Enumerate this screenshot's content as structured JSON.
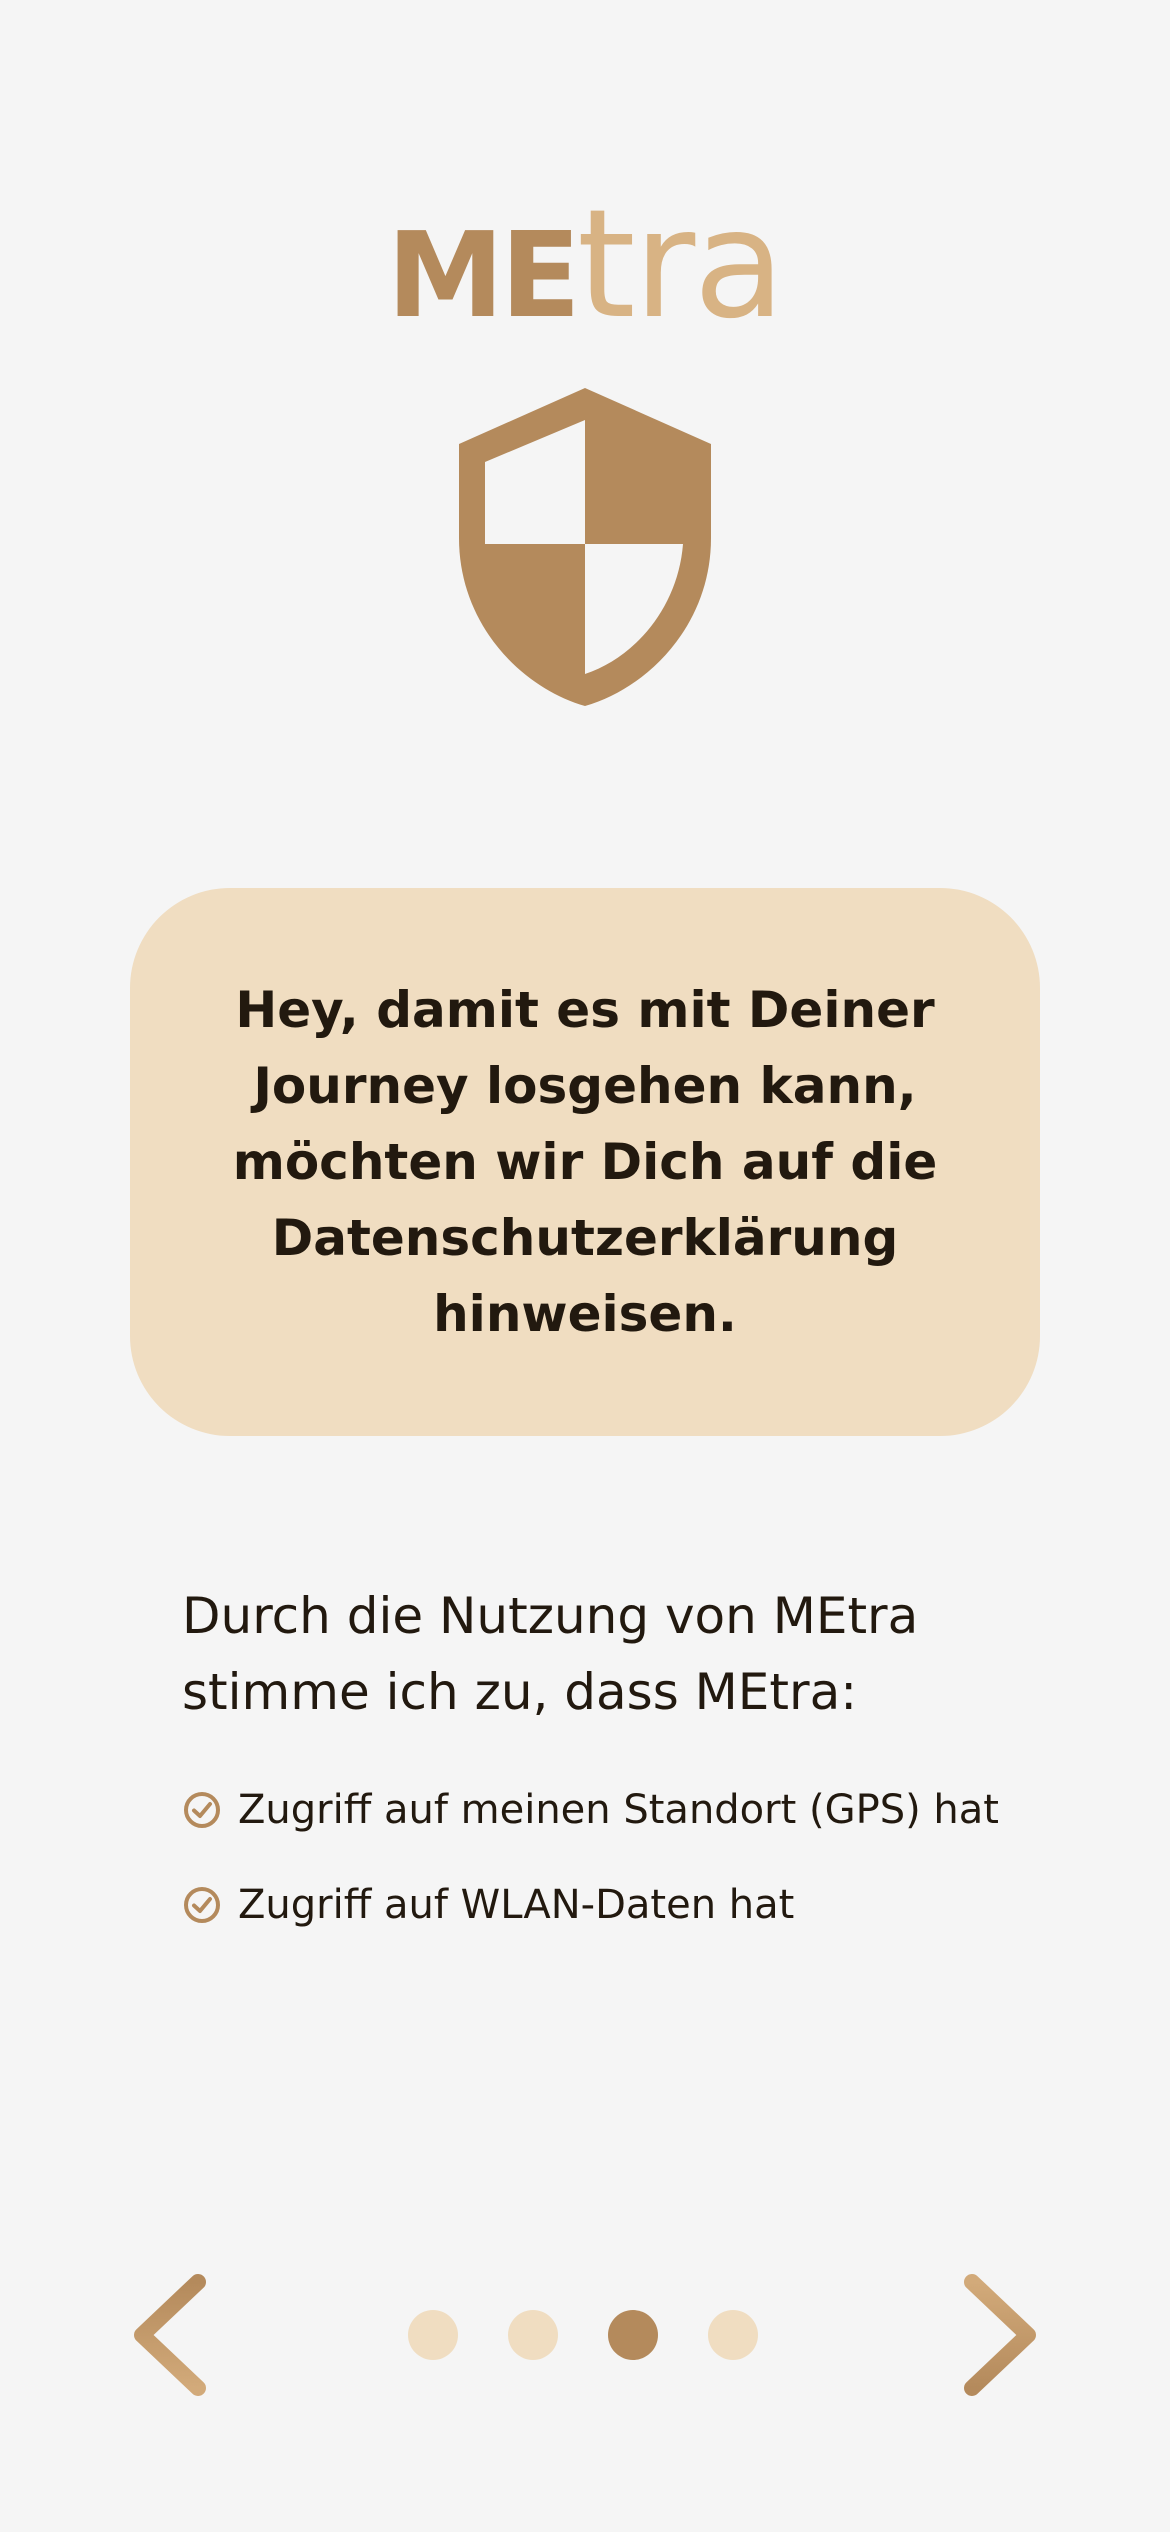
{
  "brand": {
    "logo_part1": "ME",
    "logo_part2": "tra"
  },
  "hero": {
    "icon": "shield-icon"
  },
  "card": {
    "text": "Hey, damit es mit Deiner Journey losgehen kann, möchten wir Dich auf die Datenschutzerklärung hinweisen."
  },
  "consent": {
    "intro": "Durch die Nutzung von MEtra stimme ich zu, dass MEtra:",
    "items": [
      {
        "icon": "check-circle-icon",
        "label": "Zugriff auf meinen Standort (GPS) hat"
      },
      {
        "icon": "check-circle-icon",
        "label": "Zugriff auf WLAN-Daten hat"
      }
    ]
  },
  "pager": {
    "total_pages": 4,
    "current_page": 3,
    "prev_icon": "chevron-left-icon",
    "next_icon": "chevron-right-icon"
  },
  "colors": {
    "background": "#f5f5f5",
    "brand_dark": "#b48a5c",
    "brand_light": "#d8b384",
    "card_background": "#f0ddc1",
    "text": "#22190f"
  }
}
